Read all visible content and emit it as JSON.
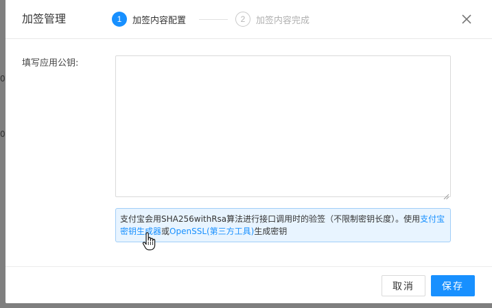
{
  "background": {
    "fragments": [
      "0",
      "0"
    ]
  },
  "dialog": {
    "title": "加签管理",
    "close_icon": "close-icon"
  },
  "steps": [
    {
      "number": "1",
      "label": "加签内容配置",
      "state": "active"
    },
    {
      "number": "2",
      "label": "加签内容完成",
      "state": "pending"
    }
  ],
  "form": {
    "label": "填写应用公钥:",
    "textarea_value": "",
    "textarea_placeholder": ""
  },
  "tip": {
    "text_before": "支付宝会用SHA256withRsa算法进行接口调用时的验签（不限制密钥长度）。使用",
    "link1": "支付宝密钥生成器",
    "text_between": "或",
    "link2": "OpenSSL(第三方工具)",
    "text_after": "生成密钥"
  },
  "footer": {
    "cancel_label": "取消",
    "save_label": "保存"
  },
  "colors": {
    "primary": "#1890ff",
    "tip_bg": "#e8f4ff",
    "tip_border": "#9fcdf8"
  }
}
